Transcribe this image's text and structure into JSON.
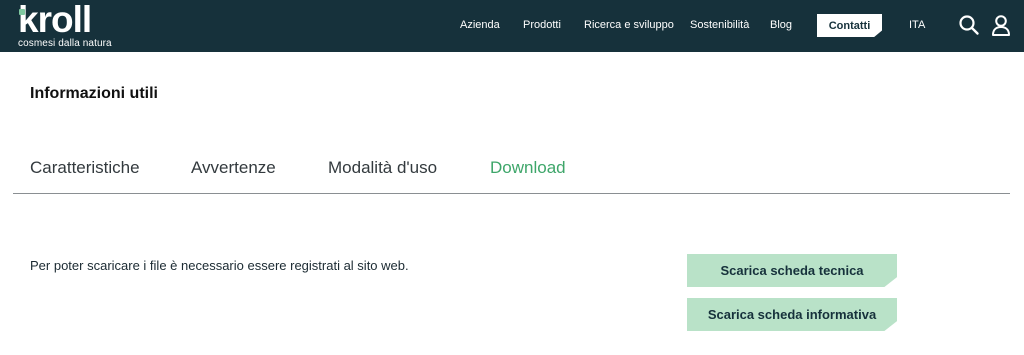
{
  "header": {
    "logo_word": "kroll",
    "logo_tagline": "cosmesi dalla natura",
    "nav": [
      "Azienda",
      "Prodotti",
      "Ricerca e sviluppo",
      "Sostenibilità",
      "Blog"
    ],
    "contact_label": "Contatti",
    "language_label": "ITA",
    "icons": {
      "search": "search-icon",
      "account": "user-icon"
    }
  },
  "section": {
    "title": "Informazioni utili"
  },
  "tabs": [
    {
      "label": "Caratteristiche",
      "active": false
    },
    {
      "label": "Avvertenze",
      "active": false
    },
    {
      "label": "Modalità d'uso",
      "active": false
    },
    {
      "label": "Download",
      "active": true
    }
  ],
  "download": {
    "notice": "Per poter scaricare i file è necessario essere registrati al sito web.",
    "buttons": [
      "Scarica scheda tecnica",
      "Scarica scheda informativa"
    ]
  },
  "colors": {
    "header_bg": "#16313b",
    "active_tab": "#3ea66a",
    "button_bg": "#b9e2c8"
  }
}
